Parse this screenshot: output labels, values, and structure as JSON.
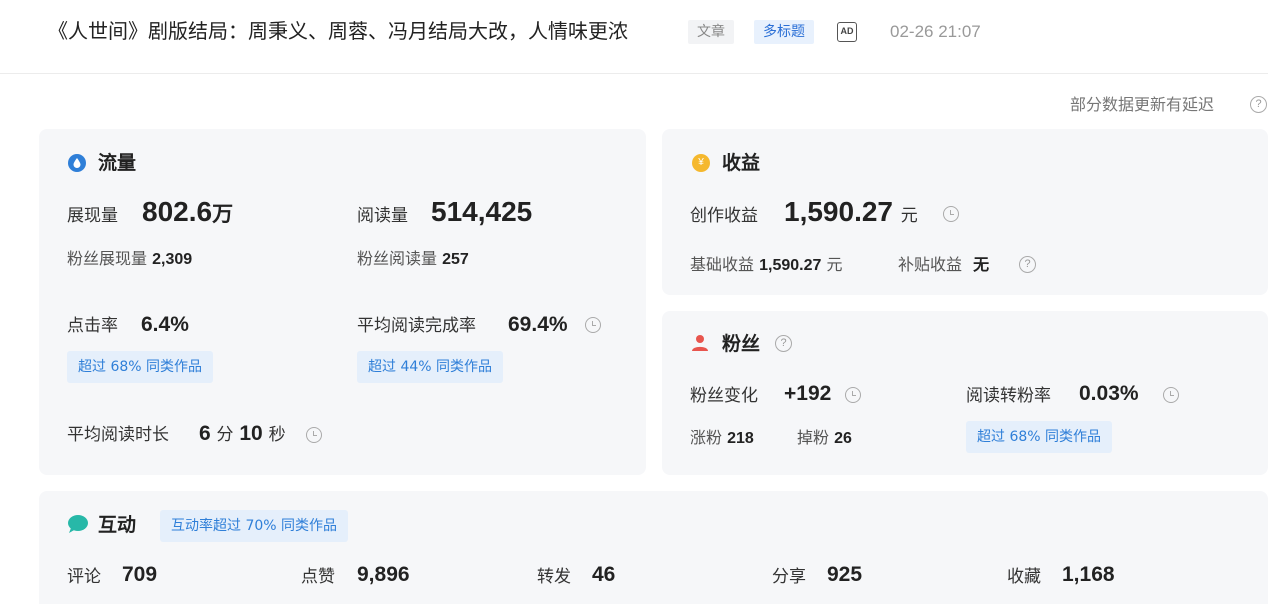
{
  "header": {
    "title": "《人世间》剧版结局：周秉义、周蓉、冯月结局大改，人情味更浓",
    "tag_type": "文章",
    "tag_multi": "多标题",
    "ad_badge": "AD",
    "date": "02-26 21:07"
  },
  "notice": {
    "delay_text": "部分数据更新有延迟",
    "help_icon": "question-icon"
  },
  "traffic": {
    "title": "流量",
    "icon": "drop-icon",
    "icon_color": "#2f7fd8",
    "impressions_label": "展现量",
    "impressions_value": "802.6",
    "impressions_unit": "万",
    "fan_impressions_label": "粉丝展现量",
    "fan_impressions_value": "2,309",
    "reads_label": "阅读量",
    "reads_value": "514,425",
    "fan_reads_label": "粉丝阅读量",
    "fan_reads_value": "257",
    "ctr_label": "点击率",
    "ctr_value": "6.4%",
    "ctr_compare": "超过 68% 同类作品",
    "completion_label": "平均阅读完成率",
    "completion_value": "69.4%",
    "completion_compare": "超过 44% 同类作品",
    "duration_label": "平均阅读时长",
    "duration_min": "6",
    "duration_min_unit": "分",
    "duration_sec": "10",
    "duration_sec_unit": "秒"
  },
  "income": {
    "title": "收益",
    "icon": "coin-icon",
    "icon_color": "#f5b82e",
    "creation_label": "创作收益",
    "creation_value": "1,590.27",
    "creation_unit": "元",
    "base_label": "基础收益",
    "base_value": "1,590.27",
    "base_unit": "元",
    "subsidy_label": "补贴收益",
    "subsidy_value": "无"
  },
  "fans": {
    "title": "粉丝",
    "icon": "person-icon",
    "icon_color": "#e8554e",
    "change_label": "粉丝变化",
    "change_value": "+192",
    "gain_label": "涨粉",
    "gain_value": "218",
    "loss_label": "掉粉",
    "loss_value": "26",
    "conv_label": "阅读转粉率",
    "conv_value": "0.03%",
    "conv_compare": "超过 68% 同类作品"
  },
  "interaction": {
    "title": "互动",
    "icon": "chat-bubble-icon",
    "icon_color": "#27b8a8",
    "compare": "互动率超过 70% 同类作品",
    "comments_label": "评论",
    "comments_value": "709",
    "likes_label": "点赞",
    "likes_value": "9,896",
    "reposts_label": "转发",
    "reposts_value": "46",
    "shares_label": "分享",
    "shares_value": "925",
    "favorites_label": "收藏",
    "favorites_value": "1,168"
  }
}
